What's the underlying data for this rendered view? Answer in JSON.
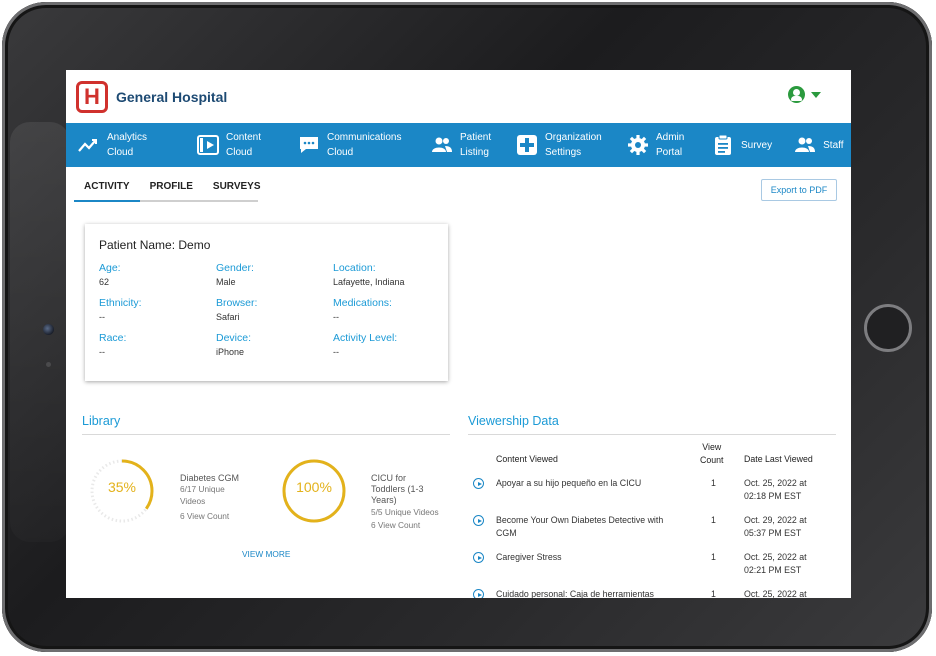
{
  "header": {
    "logo_letter": "H",
    "brand": "General Hospital",
    "brand_color": "#1d4a73",
    "accent_color": "#1b87c6"
  },
  "nav": [
    {
      "icon": "analytics-icon",
      "line1": "Analytics",
      "line2": "Cloud"
    },
    {
      "icon": "content-play-icon",
      "line1": "Content",
      "line2": "Cloud"
    },
    {
      "icon": "chat-icon",
      "line1": "Communications",
      "line2": "Cloud"
    },
    {
      "icon": "users-icon",
      "line1": "Patient",
      "line2": "Listing"
    },
    {
      "icon": "plus-icon",
      "line1": "Organization",
      "line2": "Settings"
    },
    {
      "icon": "gear-icon",
      "line1": "Admin",
      "line2": "Portal"
    },
    {
      "icon": "clipboard-icon",
      "line1": "Survey",
      "line2": ""
    },
    {
      "icon": "staff-icon",
      "line1": "Staff",
      "line2": ""
    },
    {
      "icon": "share-icon",
      "line1": "",
      "line2": ""
    }
  ],
  "tabs": [
    "ACTIVITY",
    "PROFILE",
    "SURVEYS"
  ],
  "export_label": "Export to PDF",
  "patient": {
    "title": "Patient Name: Demo",
    "fields": [
      {
        "label": "Age:",
        "value": "62"
      },
      {
        "label": "Gender:",
        "value": "Male"
      },
      {
        "label": "Location:",
        "value": "Lafayette, Indiana"
      },
      {
        "label": "Ethnicity:",
        "value": "--"
      },
      {
        "label": "Browser:",
        "value": "Safari"
      },
      {
        "label": "Medications:",
        "value": "--"
      },
      {
        "label": "Race:",
        "value": "--"
      },
      {
        "label": "Device:",
        "value": "iPhone"
      },
      {
        "label": "Activity Level:",
        "value": "--"
      }
    ]
  },
  "library": {
    "title": "Library",
    "items": [
      {
        "percent_label": "35%",
        "fraction": 0.35,
        "name": "Diabetes CGM",
        "sub1": "6/17 Unique",
        "sub2": "Videos",
        "views": "6 View Count"
      },
      {
        "percent_label": "100%",
        "fraction": 1.0,
        "name_lines": [
          "CICU for",
          "Toddlers (1-3",
          "Years)"
        ],
        "sub1": "5/5 Unique Videos",
        "views": "6 View Count"
      }
    ],
    "view_more": "VIEW MORE",
    "ring_color": "#e3b21b"
  },
  "viewership": {
    "title": "Viewership Data",
    "headers": {
      "content": "Content Viewed",
      "count_l1": "View",
      "count_l2": "Count",
      "date": "Date Last Viewed"
    },
    "rows": [
      {
        "content": [
          "Apoyar a su hijo pequeño en la CICU"
        ],
        "count": "1",
        "date": [
          "Oct. 25, 2022 at",
          "02:18 PM EST"
        ]
      },
      {
        "content": [
          "Become Your Own Diabetes Detective with",
          "CGM"
        ],
        "count": "1",
        "date": [
          "Oct. 29, 2022 at",
          "05:37 PM EST"
        ]
      },
      {
        "content": [
          "Caregiver Stress"
        ],
        "count": "1",
        "date": [
          "Oct. 25, 2022 at",
          "02:21 PM EST"
        ]
      },
      {
        "content": [
          "Cuidado personal: Caja de herramientas"
        ],
        "count": "1",
        "date": [
          "Oct. 25, 2022 at"
        ]
      }
    ]
  }
}
